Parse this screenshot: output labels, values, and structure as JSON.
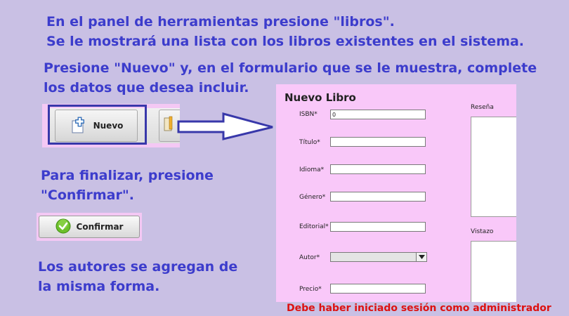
{
  "instructions": {
    "line1": "En el panel de herramientas presione \"libros\".",
    "line2": "Se le mostrará una lista con los libros existentes en el sistema.",
    "line3": "Presione \"Nuevo\" y, en el formulario que se le muestra, complete",
    "line4": "los datos que desea incluir.",
    "line5": "Para finalizar, presione",
    "line6": "\"Confirmar\".",
    "line7": "Los autores se agregan de",
    "line8": "la misma forma."
  },
  "toolbar": {
    "nuevo_label": "Nuevo",
    "nuevo_icon": "add-document-icon",
    "edit_icon": "pencil-icon"
  },
  "confirm": {
    "label": "Confirmar",
    "icon": "check-circle-icon",
    "icon_color": "#6cbf2a"
  },
  "form": {
    "title": "Nuevo Libro",
    "isbn_label": "ISBN*",
    "isbn_value": "0",
    "titulo_label": "Título*",
    "titulo_value": "",
    "idioma_label": "Idioma*",
    "idioma_value": "",
    "genero_label": "Género*",
    "genero_value": "",
    "editorial_label": "Editorial*",
    "editorial_value": "",
    "autor_label": "Autor*",
    "autor_value": "",
    "precio_label": "Precio*",
    "precio_value": "",
    "resena_label": "Reseña",
    "vistazo_label": "Vistazo"
  },
  "warning": "Debe haber iniciado sesión como administrador",
  "colors": {
    "background": "#c9c0e4",
    "instruction_text": "#3c3ccc",
    "form_background": "#f9c8f9",
    "warning_text": "#dd1111",
    "arrow": "#3838aa"
  }
}
